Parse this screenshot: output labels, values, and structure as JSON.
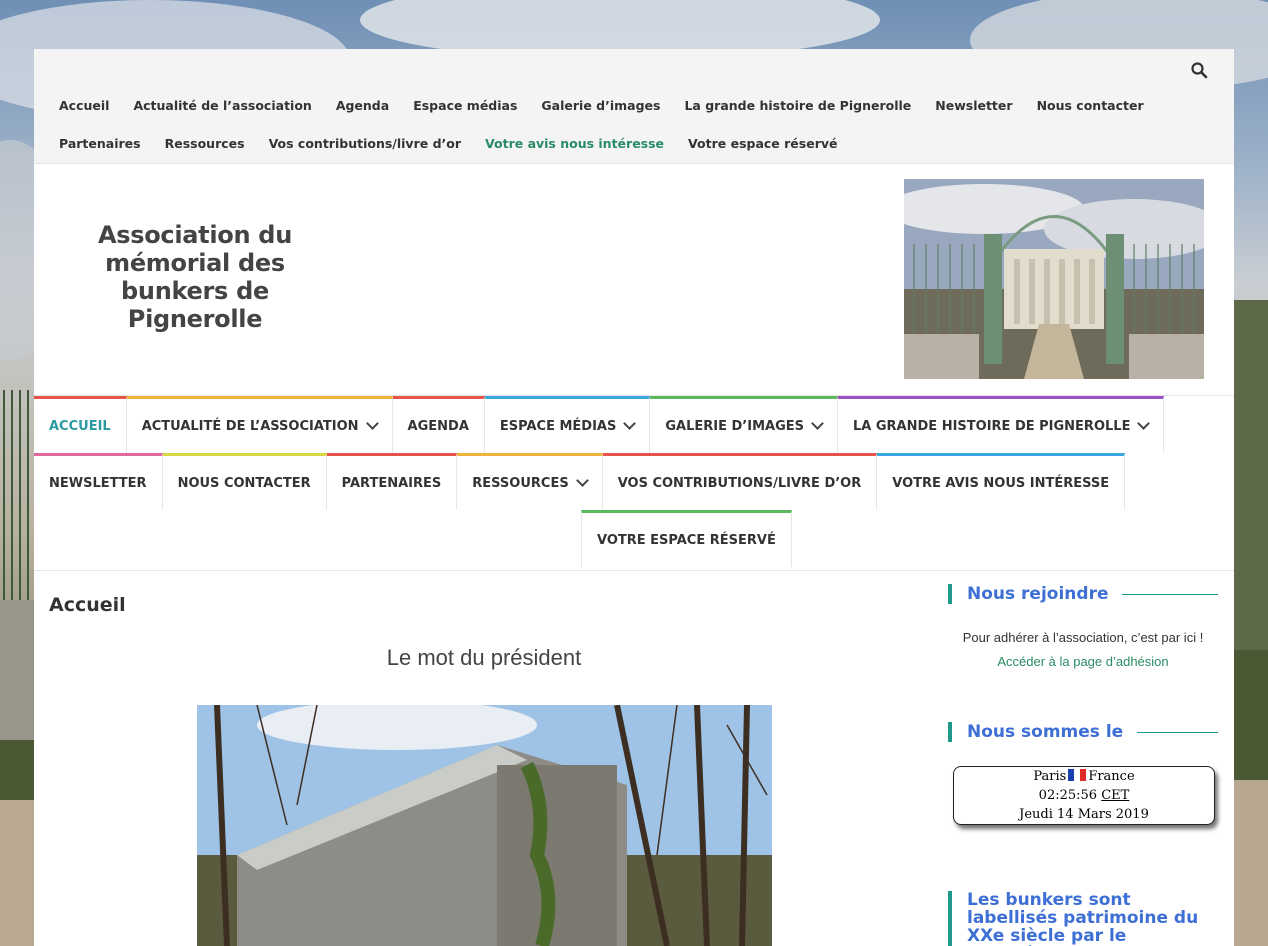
{
  "topbar": {
    "search_icon": "search-icon",
    "links": [
      {
        "label": "Accueil"
      },
      {
        "label": "Actualité de l’association"
      },
      {
        "label": "Agenda"
      },
      {
        "label": "Espace médias"
      },
      {
        "label": "Galerie d’images"
      },
      {
        "label": "La grande histoire de Pignerolle"
      },
      {
        "label": "Newsletter"
      },
      {
        "label": "Nous contacter"
      },
      {
        "label": "Partenaires"
      },
      {
        "label": "Ressources"
      },
      {
        "label": "Vos contributions/livre d’or"
      },
      {
        "label": "Votre avis nous intéresse"
      },
      {
        "label": "Votre espace réservé"
      }
    ]
  },
  "header": {
    "site_title": "Association du mémorial des bunkers de Pignerolle"
  },
  "mainnav": {
    "items": [
      {
        "label": "ACCUEIL",
        "color": "#e5534b"
      },
      {
        "label": "ACTUALITÉ DE L’ASSOCIATION",
        "color": "#f0b43c"
      },
      {
        "label": "AGENDA",
        "color": "#e5534b"
      },
      {
        "label": "ESPACE MÉDIAS",
        "color": "#3aa8e0"
      },
      {
        "label": "GALERIE D’IMAGES",
        "color": "#5cb85c"
      },
      {
        "label": "LA GRANDE HISTOIRE DE PIGNEROLLE",
        "color": "#9b4fc8"
      },
      {
        "label": "NEWSLETTER",
        "color": "#e06aa0"
      },
      {
        "label": "NOUS CONTACTER",
        "color": "#d8d840"
      },
      {
        "label": "PARTENAIRES",
        "color": "#e5534b"
      },
      {
        "label": "RESSOURCES",
        "color": "#f0b43c"
      },
      {
        "label": "VOS CONTRIBUTIONS/LIVRE D’OR",
        "color": "#e5534b"
      },
      {
        "label": "VOTRE AVIS NOUS INTÉRESSE",
        "color": "#3aa8e0"
      },
      {
        "label": "VOTRE ESPACE RÉSERVÉ",
        "color": "#5cb85c"
      }
    ]
  },
  "content": {
    "page_title": "Accueil",
    "subhead": "Le mot du président"
  },
  "sidebar": {
    "join": {
      "title": "Nous rejoindre",
      "text": "Pour adhérer à l’association, c’est par ici !",
      "link": "Accéder à la page d’adhésion"
    },
    "date": {
      "title": "Nous sommes le",
      "city": "Paris",
      "country": "France",
      "time": "02:25:56",
      "tz": "CET",
      "date": "Jeudi 14 Mars 2019"
    },
    "label": {
      "title": "Les bunkers sont labellisés patrimoine du XXe siècle par le Ministère de la"
    }
  }
}
